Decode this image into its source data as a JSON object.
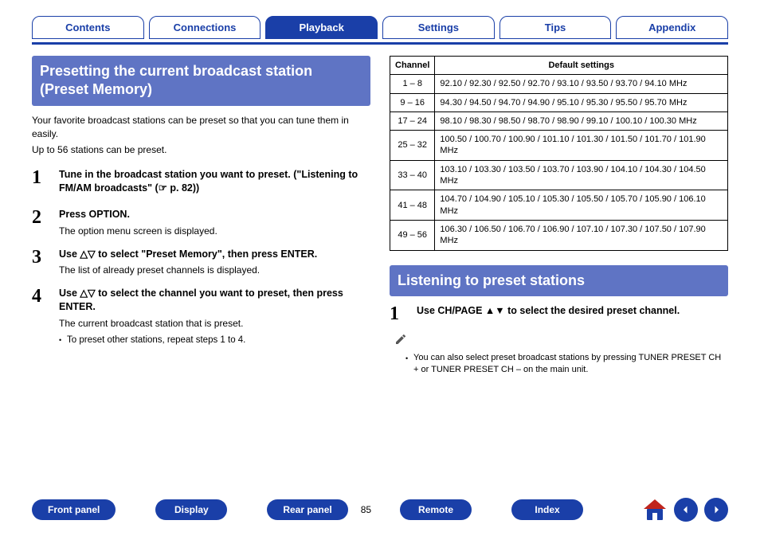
{
  "topnav": {
    "tabs": [
      "Contents",
      "Connections",
      "Playback",
      "Settings",
      "Tips",
      "Appendix"
    ],
    "active_index": 2
  },
  "left": {
    "heading": "Presetting the current broadcast station (Preset Memory)",
    "intro1": "Your favorite broadcast stations can be preset so that you can tune them in easily.",
    "intro2": "Up to 56 stations can be preset.",
    "steps": [
      {
        "num": "1",
        "title": "Tune in the broadcast station you want to preset. (\"Listening to FM/AM broadcasts\" (☞ p. 82))",
        "desc": "",
        "bullets": []
      },
      {
        "num": "2",
        "title": "Press OPTION.",
        "desc": "The option menu screen is displayed.",
        "bullets": []
      },
      {
        "num": "3",
        "title": "Use △▽ to select \"Preset Memory\", then press ENTER.",
        "desc": "The list of already preset channels is displayed.",
        "bullets": []
      },
      {
        "num": "4",
        "title": "Use △▽ to select the channel you want to preset, then press ENTER.",
        "desc": "The current broadcast station that is preset.",
        "bullets": [
          "To preset other stations, repeat steps 1 to 4."
        ]
      }
    ]
  },
  "right": {
    "table": {
      "headers": [
        "Channel",
        "Default settings"
      ],
      "rows": [
        {
          "channel": "1 – 8",
          "settings": "92.10 / 92.30 / 92.50 / 92.70 / 93.10 / 93.50 / 93.70 / 94.10 MHz"
        },
        {
          "channel": "9 – 16",
          "settings": "94.30 / 94.50 / 94.70 / 94.90 / 95.10 / 95.30 / 95.50 / 95.70 MHz"
        },
        {
          "channel": "17 – 24",
          "settings": "98.10 / 98.30 / 98.50 / 98.70 / 98.90 / 99.10 / 100.10 / 100.30 MHz"
        },
        {
          "channel": "25 – 32",
          "settings": "100.50 / 100.70 / 100.90 / 101.10 / 101.30 / 101.50 / 101.70 / 101.90 MHz"
        },
        {
          "channel": "33 – 40",
          "settings": "103.10 / 103.30 / 103.50 / 103.70 / 103.90 / 104.10 / 104.30 / 104.50 MHz"
        },
        {
          "channel": "41 – 48",
          "settings": "104.70 / 104.90 / 105.10 / 105.30 / 105.50 / 105.70 / 105.90 / 106.10 MHz"
        },
        {
          "channel": "49 – 56",
          "settings": "106.30 / 106.50 / 106.70 / 106.90 / 107.10 / 107.30 / 107.50 / 107.90 MHz"
        }
      ]
    },
    "heading2": "Listening to preset stations",
    "step": {
      "num": "1",
      "title": "Use CH/PAGE ▲▼ to select the desired preset channel."
    },
    "note": "You can also select preset broadcast stations by pressing TUNER PRESET CH + or TUNER PRESET CH – on the main unit."
  },
  "bottomnav": {
    "buttons_left": [
      "Front panel",
      "Display",
      "Rear panel"
    ],
    "page": "85",
    "buttons_right": [
      "Remote",
      "Index"
    ]
  }
}
